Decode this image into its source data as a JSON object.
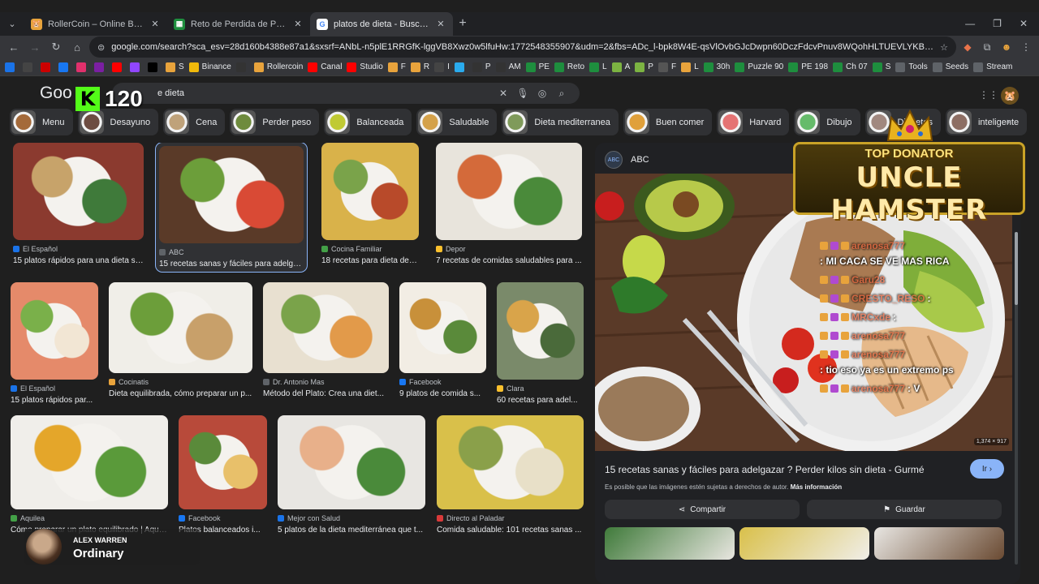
{
  "tabs": [
    {
      "title": "RollerCoin – Online Bitcoin Mining Simulator",
      "icon": "rollercoin-icon",
      "color": "#e8a33c",
      "active": false
    },
    {
      "title": "Reto de Perdida de Peso - El Mundo",
      "icon": "sheets-icon",
      "color": "#1e8e3e",
      "active": false
    },
    {
      "title": "platos de dieta - Buscar con Google",
      "icon": "google-icon",
      "color": "#4285f4",
      "active": true
    }
  ],
  "omnibox": {
    "url": "google.com/search?sca_esv=28d160b4388e87a1&sxsrf=ANbL-n5plE1RRGfK-lggVB8Xwz0w5lfuHw:1772548355907&udm=2&fbs=ADc_l-bpk8W4E-qsVlOvbGJcDwpn60DczFdcvPnuv8WQohHLTUEVLYKBrOkTsSvdYDjhWUeXlpGqCEfMfxoMLPYuw..."
  },
  "bookmarks": [
    {
      "label": "",
      "color": "#1a73e8"
    },
    {
      "label": "",
      "color": "#444"
    },
    {
      "label": "",
      "color": "#c00"
    },
    {
      "label": "",
      "color": "#1877f2"
    },
    {
      "label": "",
      "color": "#e1306c"
    },
    {
      "label": "",
      "color": "#7b1fa2"
    },
    {
      "label": "",
      "color": "#ff0000"
    },
    {
      "label": "",
      "color": "#9146ff"
    },
    {
      "label": "",
      "color": "#000"
    },
    {
      "label": "S",
      "color": "#e8a33c"
    },
    {
      "label": "Binance",
      "color": "#f0b90b"
    },
    {
      "label": "",
      "color": "#333"
    },
    {
      "label": "Rollercoin",
      "color": "#e8a33c"
    },
    {
      "label": "Canal",
      "color": "#ff0000"
    },
    {
      "label": "Studio",
      "color": "#ff0000"
    },
    {
      "label": "F",
      "color": "#e8a33c"
    },
    {
      "label": "R",
      "color": "#e8a33c"
    },
    {
      "label": "I",
      "color": "#444"
    },
    {
      "label": "",
      "color": "#2aabee"
    },
    {
      "label": "P",
      "color": "#333"
    },
    {
      "label": "AM",
      "color": "#333"
    },
    {
      "label": "PE",
      "color": "#1e8e3e"
    },
    {
      "label": "Reto",
      "color": "#1e8e3e"
    },
    {
      "label": "L",
      "color": "#1e8e3e"
    },
    {
      "label": "A",
      "color": "#7cb342"
    },
    {
      "label": "P",
      "color": "#7cb342"
    },
    {
      "label": "F",
      "color": "#555"
    },
    {
      "label": "L",
      "color": "#e8a33c"
    },
    {
      "label": "30h",
      "color": "#1e8e3e"
    },
    {
      "label": "Puzzle 90",
      "color": "#1e8e3e"
    },
    {
      "label": "PE 198",
      "color": "#1e8e3e"
    },
    {
      "label": "Ch 07",
      "color": "#1e8e3e"
    },
    {
      "label": "S",
      "color": "#1e8e3e"
    },
    {
      "label": "Tools",
      "color": "#5f6368"
    },
    {
      "label": "Seeds",
      "color": "#5f6368"
    },
    {
      "label": "Stream",
      "color": "#5f6368"
    }
  ],
  "search": {
    "logo": "Goo",
    "query": "e dieta"
  },
  "chips": [
    {
      "label": "Menu",
      "color": "#a46a3a"
    },
    {
      "label": "Desayuno",
      "color": "#6d4c41"
    },
    {
      "label": "Cena",
      "color": "#bfa27a"
    },
    {
      "label": "Perder peso",
      "color": "#6e8b3d"
    },
    {
      "label": "Balanceada",
      "color": "#c0ca33"
    },
    {
      "label": "Saludable",
      "color": "#d4a14a"
    },
    {
      "label": "Dieta mediterranea",
      "color": "#7f9a5a"
    },
    {
      "label": "Buen comer",
      "color": "#e0a03a"
    },
    {
      "label": "Harvard",
      "color": "#e57373"
    },
    {
      "label": "Dibujo",
      "color": "#66bb6a"
    },
    {
      "label": "Diabetes",
      "color": "#a1887f"
    },
    {
      "label": "inteligente",
      "color": "#8d6e63"
    }
  ],
  "results": [
    {
      "source": "El Español",
      "title": "15 platos rápidos para una dieta sa...",
      "colors": [
        "#8b3a2f",
        "#c7a36a",
        "#3f7a3a"
      ],
      "sc": "#1a73e8"
    },
    {
      "source": "ABC",
      "title": "15 recetas sanas y fáciles para adelgaz...",
      "colors": [
        "#5a3a28",
        "#6c9e3a",
        "#d94a35"
      ],
      "sc": "#5f6368"
    },
    {
      "source": "Cocina Familiar",
      "title": "18 recetas para dieta de co...",
      "colors": [
        "#d9b24a",
        "#7aa34a",
        "#b84a2a"
      ],
      "sc": "#43a047"
    },
    {
      "source": "Depor",
      "title": "7 recetas de comidas saludables para ...",
      "colors": [
        "#e8e4dc",
        "#d46a3a",
        "#4a8a3a"
      ],
      "sc": "#fbc02d"
    },
    {
      "source": "El Español",
      "title": "15 platos rápidos par...",
      "colors": [
        "#e58a6a",
        "#7ab04a",
        "#f2e6d4"
      ],
      "sc": "#1a73e8"
    },
    {
      "source": "Cocinatis",
      "title": "Dieta equilibrada, cómo preparar un p...",
      "colors": [
        "#f0eee8",
        "#6c9e3a",
        "#c8a06a"
      ],
      "sc": "#e8a33c"
    },
    {
      "source": "Dr. Antonio Mas",
      "title": "Método del Plato: Crea una diet...",
      "colors": [
        "#e8e0d0",
        "#7aa34a",
        "#e29a4a"
      ],
      "sc": "#5f6368"
    },
    {
      "source": "Facebook",
      "title": "9 platos de comida s...",
      "colors": [
        "#f2ede4",
        "#c8903a",
        "#5a8a3a"
      ],
      "sc": "#1877f2"
    },
    {
      "source": "Clara",
      "title": "60 recetas para adel...",
      "colors": [
        "#7a8a6a",
        "#d9a44a",
        "#4a6a3a"
      ],
      "sc": "#fbc02d"
    },
    {
      "source": "Aquilea",
      "title": "Cómo preparar un plato equilibrado | Aquilea",
      "colors": [
        "#f0eeea",
        "#e4a62a",
        "#5a9a3a"
      ],
      "sc": "#43a047"
    },
    {
      "source": "Facebook",
      "title": "Platos balanceados i...",
      "colors": [
        "#b84a3a",
        "#5a8a3a",
        "#e8c06a"
      ],
      "sc": "#1877f2"
    },
    {
      "source": "Mejor con Salud",
      "title": "5 platos de la dieta mediterránea que t...",
      "colors": [
        "#e8e6e2",
        "#e8b08a",
        "#4a8a3a"
      ],
      "sc": "#1a73e8"
    },
    {
      "source": "Directo al Paladar",
      "title": "Comida saludable: 101 recetas sanas ...",
      "colors": [
        "#d9c04a",
        "#8aa04a",
        "#e8e0c8"
      ],
      "sc": "#d93a3a"
    }
  ],
  "side_panel": {
    "source": "ABC",
    "source_badge": "ABC",
    "dimensions": "1,374 × 917",
    "title": "15 recetas sanas y fáciles para adelgazar ? Perder kilos sin dieta - Gurmé",
    "go_label": "Ir",
    "copyright": "Es posible que las imágenes estén sujetas a derechos de autor.",
    "more_info": "Más información",
    "share_label": "Compartir",
    "save_label": "Guardar"
  },
  "overlays": {
    "kick_count": "120",
    "top_donator_label": "TOP DONATOR",
    "top_donator_name": "UNCLE HAMSTER",
    "chat": [
      {
        "user": "arenosa777",
        "text": ": MI CACA SE VE MAS RICA"
      },
      {
        "user": "Garu28",
        "text": ""
      },
      {
        "user": "CRESTO_RESO",
        "text": ":"
      },
      {
        "user": "MRCxde",
        "text": ":"
      },
      {
        "user": "arenosa777",
        "text": ""
      },
      {
        "user": "arenosa777",
        "text": ": tio eso ya es un extremo ps"
      },
      {
        "user": "arenosa777",
        "text": ": V"
      }
    ],
    "now_playing_artist": "ALEX WARREN",
    "now_playing_song": "Ordinary"
  }
}
